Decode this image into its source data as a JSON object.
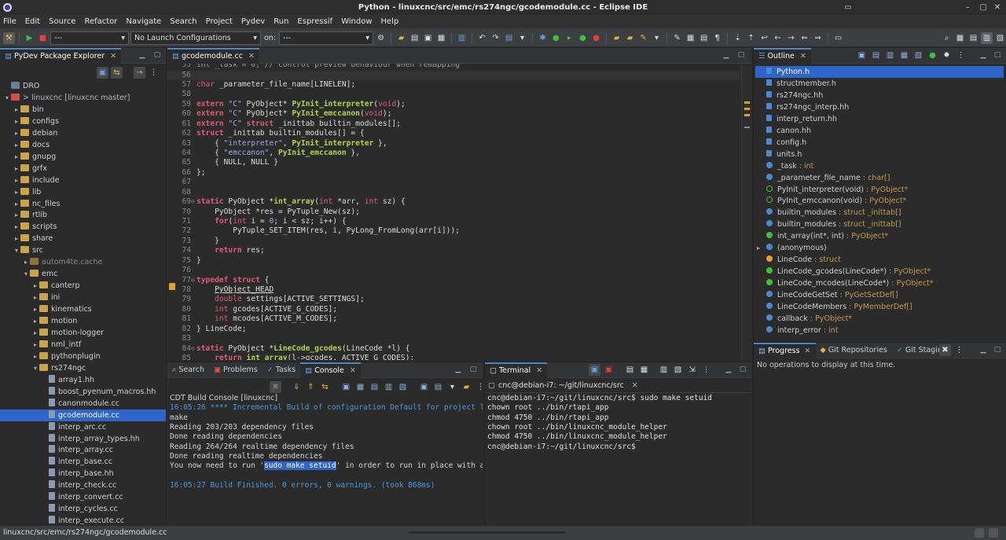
{
  "window": {
    "title": "Python - linuxcnc/src/emc/rs274ngc/gcodemodule.cc - Eclipse IDE"
  },
  "menu": [
    "File",
    "Edit",
    "Source",
    "Refactor",
    "Navigate",
    "Search",
    "Project",
    "Pydev",
    "Run",
    "Espressif",
    "Window",
    "Help"
  ],
  "toolbar": {
    "mode_combo": "---",
    "launch_combo": "No Launch Configurations",
    "on_label": "on:",
    "target_combo": "---"
  },
  "explorer": {
    "tab": "PyDev Package Explorer",
    "rows": [
      {
        "label": "DRO",
        "depth": 0,
        "arrow": "",
        "type": "project"
      },
      {
        "label": "> linuxcnc [linuxcnc master]",
        "depth": 0,
        "arrow": "▾",
        "type": "repo"
      },
      {
        "label": "bin",
        "depth": 1,
        "arrow": "▸",
        "type": "folder"
      },
      {
        "label": "configs",
        "depth": 1,
        "arrow": "▸",
        "type": "folder"
      },
      {
        "label": "debian",
        "depth": 1,
        "arrow": "▸",
        "type": "folder"
      },
      {
        "label": "docs",
        "depth": 1,
        "arrow": "▸",
        "type": "folder"
      },
      {
        "label": "gnupg",
        "depth": 1,
        "arrow": "▸",
        "type": "folder"
      },
      {
        "label": "grfx",
        "depth": 1,
        "arrow": "▸",
        "type": "folder"
      },
      {
        "label": "include",
        "depth": 1,
        "arrow": "▸",
        "type": "folder"
      },
      {
        "label": "lib",
        "depth": 1,
        "arrow": "▸",
        "type": "folder"
      },
      {
        "label": "nc_files",
        "depth": 1,
        "arrow": "▸",
        "type": "folder"
      },
      {
        "label": "rtlib",
        "depth": 1,
        "arrow": "▸",
        "type": "folder"
      },
      {
        "label": "scripts",
        "depth": 1,
        "arrow": "▸",
        "type": "folder"
      },
      {
        "label": "share",
        "depth": 1,
        "arrow": "▸",
        "type": "folder"
      },
      {
        "label": "src",
        "depth": 1,
        "arrow": "▾",
        "type": "folder"
      },
      {
        "label": "autom4te.cache",
        "depth": 2,
        "arrow": "▸",
        "type": "folder-dim"
      },
      {
        "label": "emc",
        "depth": 2,
        "arrow": "▾",
        "type": "folder"
      },
      {
        "label": "canterp",
        "depth": 3,
        "arrow": "▸",
        "type": "folder"
      },
      {
        "label": "ini",
        "depth": 3,
        "arrow": "▸",
        "type": "folder"
      },
      {
        "label": "kinematics",
        "depth": 3,
        "arrow": "▸",
        "type": "folder"
      },
      {
        "label": "motion",
        "depth": 3,
        "arrow": "▸",
        "type": "folder"
      },
      {
        "label": "motion-logger",
        "depth": 3,
        "arrow": "▸",
        "type": "folder"
      },
      {
        "label": "nml_intf",
        "depth": 3,
        "arrow": "▸",
        "type": "folder"
      },
      {
        "label": "pythonplugin",
        "depth": 3,
        "arrow": "▸",
        "type": "folder"
      },
      {
        "label": "rs274ngc",
        "depth": 3,
        "arrow": "▾",
        "type": "folder"
      },
      {
        "label": "array1.hh",
        "depth": 4,
        "arrow": "",
        "type": "file"
      },
      {
        "label": "boost_pyenum_macros.hh",
        "depth": 4,
        "arrow": "",
        "type": "file"
      },
      {
        "label": "canonmodule.cc",
        "depth": 4,
        "arrow": "",
        "type": "file"
      },
      {
        "label": "gcodemodule.cc",
        "depth": 4,
        "arrow": "",
        "type": "file",
        "selected": true
      },
      {
        "label": "interp_arc.cc",
        "depth": 4,
        "arrow": "",
        "type": "file"
      },
      {
        "label": "interp_array_types.hh",
        "depth": 4,
        "arrow": "",
        "type": "file"
      },
      {
        "label": "interp_array.cc",
        "depth": 4,
        "arrow": "",
        "type": "file"
      },
      {
        "label": "interp_base.cc",
        "depth": 4,
        "arrow": "",
        "type": "file"
      },
      {
        "label": "interp_base.hh",
        "depth": 4,
        "arrow": "",
        "type": "file"
      },
      {
        "label": "interp_check.cc",
        "depth": 4,
        "arrow": "",
        "type": "file"
      },
      {
        "label": "interp_convert.cc",
        "depth": 4,
        "arrow": "",
        "type": "file"
      },
      {
        "label": "interp_cycles.cc",
        "depth": 4,
        "arrow": "",
        "type": "file"
      },
      {
        "label": "interp_execute.cc",
        "depth": 4,
        "arrow": "",
        "type": "file"
      }
    ]
  },
  "editor": {
    "tab": "gcodemodule.cc",
    "top_partial": "int _task = 0; // control preview behaviour when remapping",
    "lines": [
      {
        "n": "56",
        "tokens": []
      },
      {
        "n": "57",
        "tokens": [
          [
            "ty",
            "char"
          ],
          [
            "sym",
            " _parameter_file_name[LINELEN];"
          ]
        ]
      },
      {
        "n": "58",
        "tokens": []
      },
      {
        "n": "59",
        "tokens": [
          [
            "kw",
            "extern"
          ],
          [
            "sym",
            " "
          ],
          [
            "str",
            "\"C\""
          ],
          [
            "sym",
            " PyObject* "
          ],
          [
            "fn",
            "PyInit_interpreter"
          ],
          [
            "sym",
            "("
          ],
          [
            "ty",
            "void"
          ],
          [
            "sym",
            ");"
          ]
        ]
      },
      {
        "n": "60",
        "tokens": [
          [
            "kw",
            "extern"
          ],
          [
            "sym",
            " "
          ],
          [
            "str",
            "\"C\""
          ],
          [
            "sym",
            " PyObject* "
          ],
          [
            "fn",
            "PyInit_emccanon"
          ],
          [
            "sym",
            "("
          ],
          [
            "ty",
            "void"
          ],
          [
            "sym",
            ");"
          ]
        ]
      },
      {
        "n": "61",
        "tokens": [
          [
            "kw",
            "extern"
          ],
          [
            "sym",
            " "
          ],
          [
            "str",
            "\"C\""
          ],
          [
            "sym",
            " "
          ],
          [
            "kw",
            "struct"
          ],
          [
            "sym",
            " _inittab builtin_modules[];"
          ]
        ]
      },
      {
        "n": "62",
        "tokens": [
          [
            "kw",
            "struct"
          ],
          [
            "sym",
            " _inittab builtin_modules[] = {"
          ]
        ]
      },
      {
        "n": "63",
        "tokens": [
          [
            "sym",
            "    { "
          ],
          [
            "str",
            "\"interpreter\""
          ],
          [
            "sym",
            ", "
          ],
          [
            "fn",
            "PyInit_interpreter"
          ],
          [
            "sym",
            " },"
          ]
        ]
      },
      {
        "n": "64",
        "tokens": [
          [
            "sym",
            "    { "
          ],
          [
            "str",
            "\"emccanon\""
          ],
          [
            "sym",
            ", "
          ],
          [
            "fn",
            "PyInit_emccanon"
          ],
          [
            "sym",
            " },"
          ]
        ]
      },
      {
        "n": "65",
        "tokens": [
          [
            "sym",
            "    { NULL, NULL }"
          ]
        ]
      },
      {
        "n": "66",
        "tokens": [
          [
            "sym",
            "};"
          ]
        ]
      },
      {
        "n": "67",
        "tokens": []
      },
      {
        "n": "68",
        "tokens": []
      },
      {
        "n": "69",
        "tokens": [
          [
            "kw",
            "static"
          ],
          [
            "sym",
            " PyObject *"
          ],
          [
            "fn",
            "int_array"
          ],
          [
            "sym",
            "("
          ],
          [
            "ty",
            "int"
          ],
          [
            "sym",
            " *arr, "
          ],
          [
            "ty",
            "int"
          ],
          [
            "sym",
            " sz) {"
          ]
        ]
      },
      {
        "n": "70",
        "tokens": [
          [
            "sym",
            "    PyObject *res = PyTuple_New(sz);"
          ]
        ]
      },
      {
        "n": "71",
        "tokens": [
          [
            "sym",
            "    "
          ],
          [
            "kw",
            "for"
          ],
          [
            "sym",
            "("
          ],
          [
            "ty",
            "int"
          ],
          [
            "sym",
            " i = "
          ],
          [
            "str",
            "0"
          ],
          [
            "sym",
            "; i < sz; i++) {"
          ]
        ]
      },
      {
        "n": "72",
        "tokens": [
          [
            "sym",
            "        PyTuple_SET_ITEM(res, i, PyLong_FromLong(arr[i]));"
          ]
        ]
      },
      {
        "n": "73",
        "tokens": [
          [
            "sym",
            "    }"
          ]
        ]
      },
      {
        "n": "74",
        "tokens": [
          [
            "sym",
            "    "
          ],
          [
            "kw",
            "return"
          ],
          [
            "sym",
            " res;"
          ]
        ]
      },
      {
        "n": "75",
        "tokens": [
          [
            "sym",
            "}"
          ]
        ]
      },
      {
        "n": "76",
        "tokens": []
      },
      {
        "n": "77",
        "tokens": [
          [
            "kw",
            "typedef"
          ],
          [
            "sym",
            " "
          ],
          [
            "kw",
            "struct"
          ],
          [
            "sym",
            " {"
          ]
        ]
      },
      {
        "n": "78",
        "tokens": [
          [
            "sym",
            "    "
          ],
          [
            "mac",
            "PyObject_HEAD"
          ]
        ]
      },
      {
        "n": "79",
        "tokens": [
          [
            "sym",
            "    "
          ],
          [
            "ty",
            "double"
          ],
          [
            "sym",
            " settings[ACTIVE_SETTINGS];"
          ]
        ]
      },
      {
        "n": "80",
        "tokens": [
          [
            "sym",
            "    "
          ],
          [
            "ty",
            "int"
          ],
          [
            "sym",
            " gcodes[ACTIVE_G_CODES];"
          ]
        ]
      },
      {
        "n": "81",
        "tokens": [
          [
            "sym",
            "    "
          ],
          [
            "ty",
            "int"
          ],
          [
            "sym",
            " mcodes[ACTIVE_M_CODES];"
          ]
        ]
      },
      {
        "n": "82",
        "tokens": [
          [
            "sym",
            "} LineCode;"
          ]
        ]
      },
      {
        "n": "83",
        "tokens": []
      },
      {
        "n": "84",
        "tokens": [
          [
            "kw",
            "static"
          ],
          [
            "sym",
            " PyObject *"
          ],
          [
            "fn",
            "LineCode_gcodes"
          ],
          [
            "sym",
            "(LineCode *l) {"
          ]
        ]
      },
      {
        "n": "85",
        "tokens": [
          [
            "sym",
            "    "
          ],
          [
            "kw",
            "return"
          ],
          [
            "sym",
            " "
          ],
          [
            "fn",
            "int_array"
          ],
          [
            "sym",
            "(l->gcodes, ACTIVE_G_CODES);"
          ]
        ]
      }
    ]
  },
  "bottom_left": {
    "tabs": [
      "Search",
      "Problems",
      "Tasks",
      "Console"
    ],
    "console_title": "CDT Build Console [linuxcnc]",
    "lines": [
      {
        "text": "16:05:26 **** Incremental Build of configuration Default for project linuxcnc",
        "cls": "blue"
      },
      {
        "text": "make",
        "cls": ""
      },
      {
        "text": "Reading 203/203 dependency files",
        "cls": ""
      },
      {
        "text": "Done reading dependencies",
        "cls": ""
      },
      {
        "text": "Reading 264/264 realtime dependency files",
        "cls": ""
      },
      {
        "text": "Done reading realtime dependencies",
        "cls": ""
      },
      {
        "text": "You now need to run 'sudo make setuid' in order to run in place with access to hardware.",
        "cls": "hl"
      },
      {
        "text": "",
        "cls": ""
      },
      {
        "text": "16:05:27 Build Finished. 0 errors, 0 warnings. (took 868ms)",
        "cls": "blue"
      }
    ],
    "highlight": "sudo make setuid"
  },
  "terminal": {
    "tab": "Terminal",
    "session": "cnc@debian-i7: ~/git/linuxcnc/src",
    "lines": [
      "cnc@debian-i7:~/git/linuxcnc/src$ sudo make setuid",
      "chown root ../bin/rtapi_app",
      "chmod 4750 ../bin/rtapi_app",
      "chown root ../bin/linuxcnc_module_helper",
      "chmod 4750 ../bin/linuxcnc_module_helper",
      "cnc@debian-i7:~/git/linuxcnc/src$"
    ]
  },
  "outline": {
    "tab": "Outline",
    "rows": [
      {
        "name": "Python.h",
        "type": "",
        "icon": "include",
        "selected": true
      },
      {
        "name": "structmember.h",
        "type": "",
        "icon": "include"
      },
      {
        "name": "rs274ngc.hh",
        "type": "",
        "icon": "include"
      },
      {
        "name": "rs274ngc_interp.hh",
        "type": "",
        "icon": "include"
      },
      {
        "name": "interp_return.hh",
        "type": "",
        "icon": "include"
      },
      {
        "name": "canon.hh",
        "type": "",
        "icon": "include"
      },
      {
        "name": "config.h",
        "type": "",
        "icon": "include"
      },
      {
        "name": "units.h",
        "type": "",
        "icon": "include"
      },
      {
        "name": "_task",
        "type": " : int",
        "icon": "var"
      },
      {
        "name": "_parameter_file_name",
        "type": " : char[]",
        "icon": "var"
      },
      {
        "name": "PyInit_interpreter(void)",
        "type": " : PyObject*",
        "icon": "func-decl"
      },
      {
        "name": "PyInit_emccanon(void)",
        "type": " : PyObject*",
        "icon": "func-decl"
      },
      {
        "name": "builtin_modules",
        "type": " : struct _inittab[]",
        "icon": "var"
      },
      {
        "name": "builtin_modules",
        "type": " : struct _inittab[]",
        "icon": "var"
      },
      {
        "name": "int_array(int*, int)",
        "type": " : PyObject*",
        "icon": "func"
      },
      {
        "name": "(anonymous)",
        "type": "",
        "icon": "struct",
        "arrow": "▸"
      },
      {
        "name": "LineCode",
        "type": " : struct",
        "icon": "typedef"
      },
      {
        "name": "LineCode_gcodes(LineCode*)",
        "type": " : PyObject*",
        "icon": "func"
      },
      {
        "name": "LineCode_mcodes(LineCode*)",
        "type": " : PyObject*",
        "icon": "func"
      },
      {
        "name": "LineCodeGetSet",
        "type": " : PyGetSetDef[]",
        "icon": "var"
      },
      {
        "name": "LineCodeMembers",
        "type": " : PyMemberDef[]",
        "icon": "var"
      },
      {
        "name": "callback",
        "type": " : PyObject*",
        "icon": "var"
      },
      {
        "name": "interp_error",
        "type": " : int",
        "icon": "var"
      }
    ]
  },
  "progress": {
    "tabs": [
      "Progress",
      "Git Repositories",
      "Git Staging"
    ],
    "message": "No operations to display at this time."
  },
  "status": {
    "path": "linuxcnc/src/emc/rs274ngc/gcodemodule.cc"
  }
}
